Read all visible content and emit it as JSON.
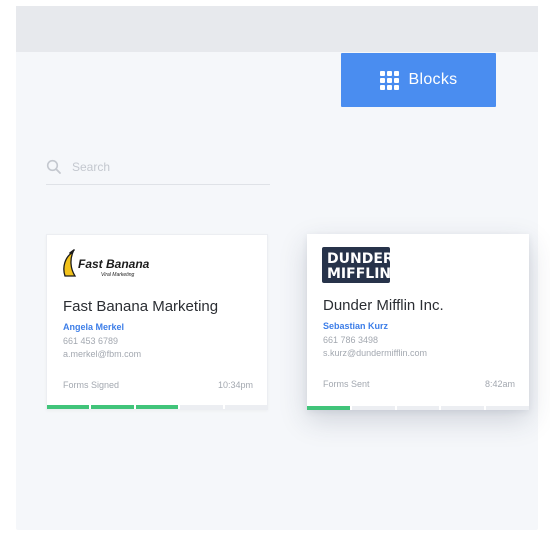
{
  "toolbar": {
    "view_button_label": "Blocks"
  },
  "search": {
    "placeholder": "Search",
    "value": ""
  },
  "cards": [
    {
      "logo_text": "Fast Banana",
      "logo_tagline": "Viral Marketing",
      "company": "Fast Banana Marketing",
      "contact": "Angela Merkel",
      "phone": "661 453 6789",
      "email": "a.merkel@fbm.com",
      "status": "Forms Signed",
      "time": "10:34pm",
      "progress_steps_total": 5,
      "progress_steps_done": 3
    },
    {
      "logo_text_line1": "DUNDER",
      "logo_text_line2": "MIFFLIN",
      "company": "Dunder Mifflin Inc.",
      "contact": "Sebastian Kurz",
      "phone": "661 786 3498",
      "email": "s.kurz@dundermifflin.com",
      "status": "Forms Sent",
      "time": "8:42am",
      "progress_steps_total": 5,
      "progress_steps_done": 1
    }
  ],
  "colors": {
    "accent": "#4a8df0",
    "contact_link": "#3d7ee8",
    "progress_done": "#41c47a",
    "progress_todo": "#eceef2"
  }
}
